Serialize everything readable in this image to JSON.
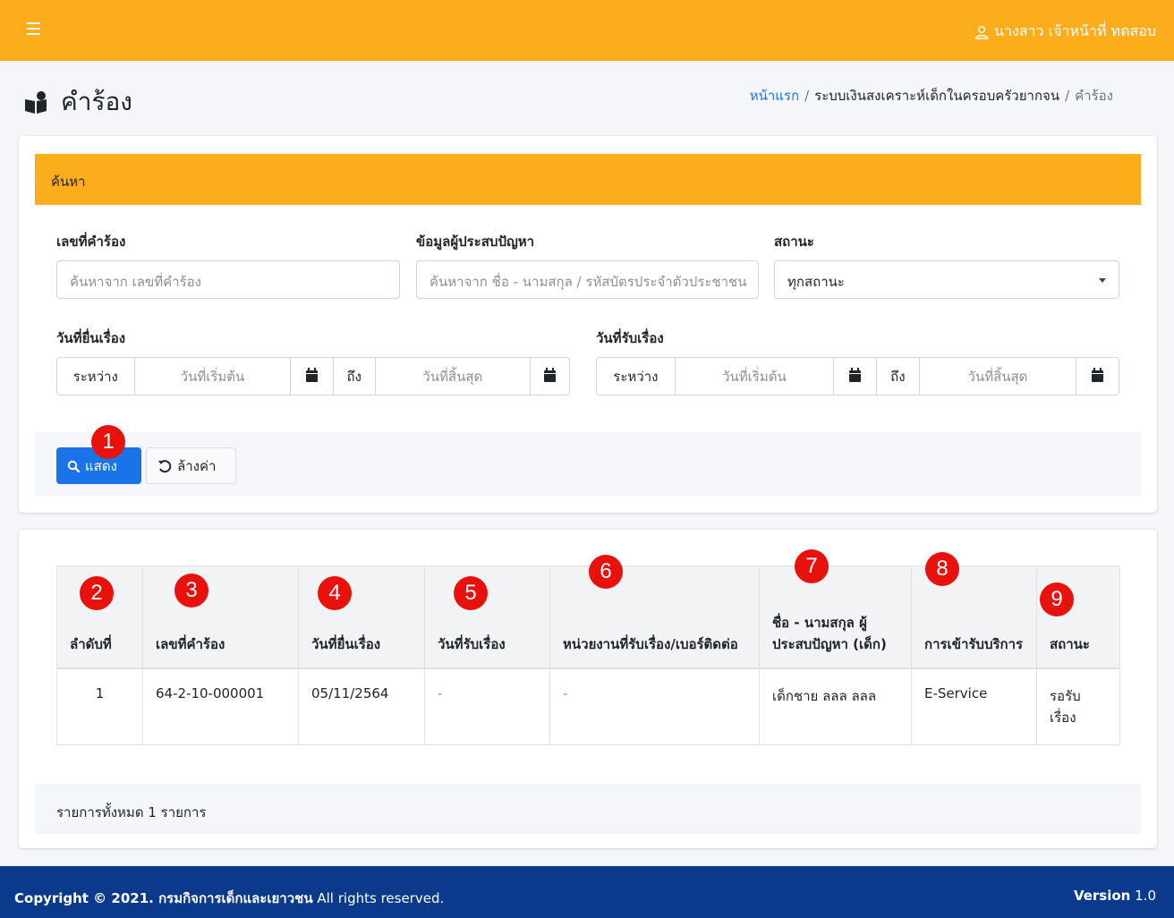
{
  "topbar": {
    "menu_icon": "hamburger-icon",
    "user_icon": "user-icon",
    "user_name": "นางสาว เจ้าหน้าที่ ทดสอบ"
  },
  "page": {
    "title_icon": "users-icon",
    "title": "คำร้อง",
    "breadcrumb": {
      "home": "หน้าแรก",
      "section": "ระบบเงินสงเคราะห์เด็กในครอบครัวยากจน",
      "current": "คำร้อง",
      "separator": "/"
    }
  },
  "search": {
    "header": "ค้นหา",
    "request_no_label": "เลขที่คำร้อง",
    "request_no_placeholder": "ค้นหาจาก เลขที่คำร้อง",
    "person_label": "ข้อมูลผู้ประสบปัญหา",
    "person_placeholder": "ค้นหาจาก ชื่อ - นามสกุล / รหัสบัตรประจำตัวประชาชน",
    "status_label": "สถานะ",
    "status_value": "ทุกสถานะ",
    "submit_date_label": "วันที่ยื่นเรื่อง",
    "receive_date_label": "วันที่รับเรื่อง",
    "between": "ระหว่าง",
    "to": "ถึง",
    "start_placeholder": "วันที่เริ่มต้น",
    "end_placeholder": "วันที่สิ้นสุด",
    "show_button": "แสดง",
    "reset_button": "ล้างค่า"
  },
  "badges": [
    "1",
    "2",
    "3",
    "4",
    "5",
    "6",
    "7",
    "8",
    "9"
  ],
  "table": {
    "headers": [
      "ลำดับที่",
      "เลขที่คำร้อง",
      "วันที่ยื่นเรื่อง",
      "วันที่รับเรื่อง",
      "หน่วยงานที่รับเรื่อง/เบอร์ติดต่อ",
      "ชื่อ - นามสกุล ผู้ประสบปัญหา (เด็ก)",
      "การเข้ารับบริการ",
      "สถานะ"
    ],
    "rows": [
      [
        "1",
        "64-2-10-000001",
        "05/11/2564",
        "-",
        "-",
        "เด็กชาย ลลล ลลล",
        "E-Service",
        "รอรับเรื่อง"
      ]
    ],
    "total": "รายการทั้งหมด 1 รายการ"
  },
  "footer": {
    "copyright": "Copyright © 2021. กรมกิจการเด็กและเยาวชน",
    "rights": "All rights reserved.",
    "version_label": "Version",
    "version": "1.0"
  },
  "colors": {
    "topbar": "#fbad1b",
    "primary": "#1a73e8",
    "footer": "#0b3a8c",
    "badge": "#e8110c"
  }
}
